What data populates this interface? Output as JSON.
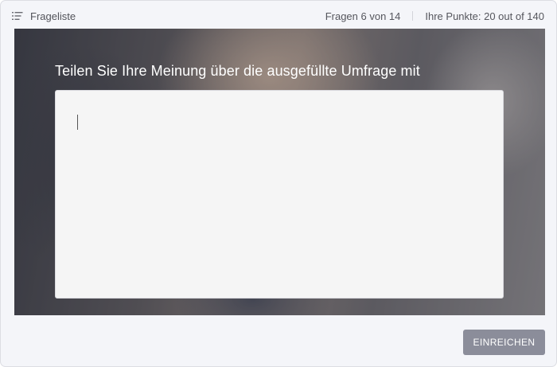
{
  "header": {
    "question_list_label": "Frageliste",
    "progress_text": "Fragen 6 von 14",
    "points_text": "Ihre Punkte: 20 out of 140"
  },
  "question": {
    "title": "Teilen Sie Ihre Meinung über die ausgefüllte Umfrage mit",
    "answer_value": "",
    "answer_placeholder": ""
  },
  "footer": {
    "submit_label": "EINREICHEN"
  },
  "colors": {
    "submit_button": "#8b8d9a",
    "background": "#f4f5f9"
  },
  "icons": {
    "question_list": "list-icon"
  }
}
